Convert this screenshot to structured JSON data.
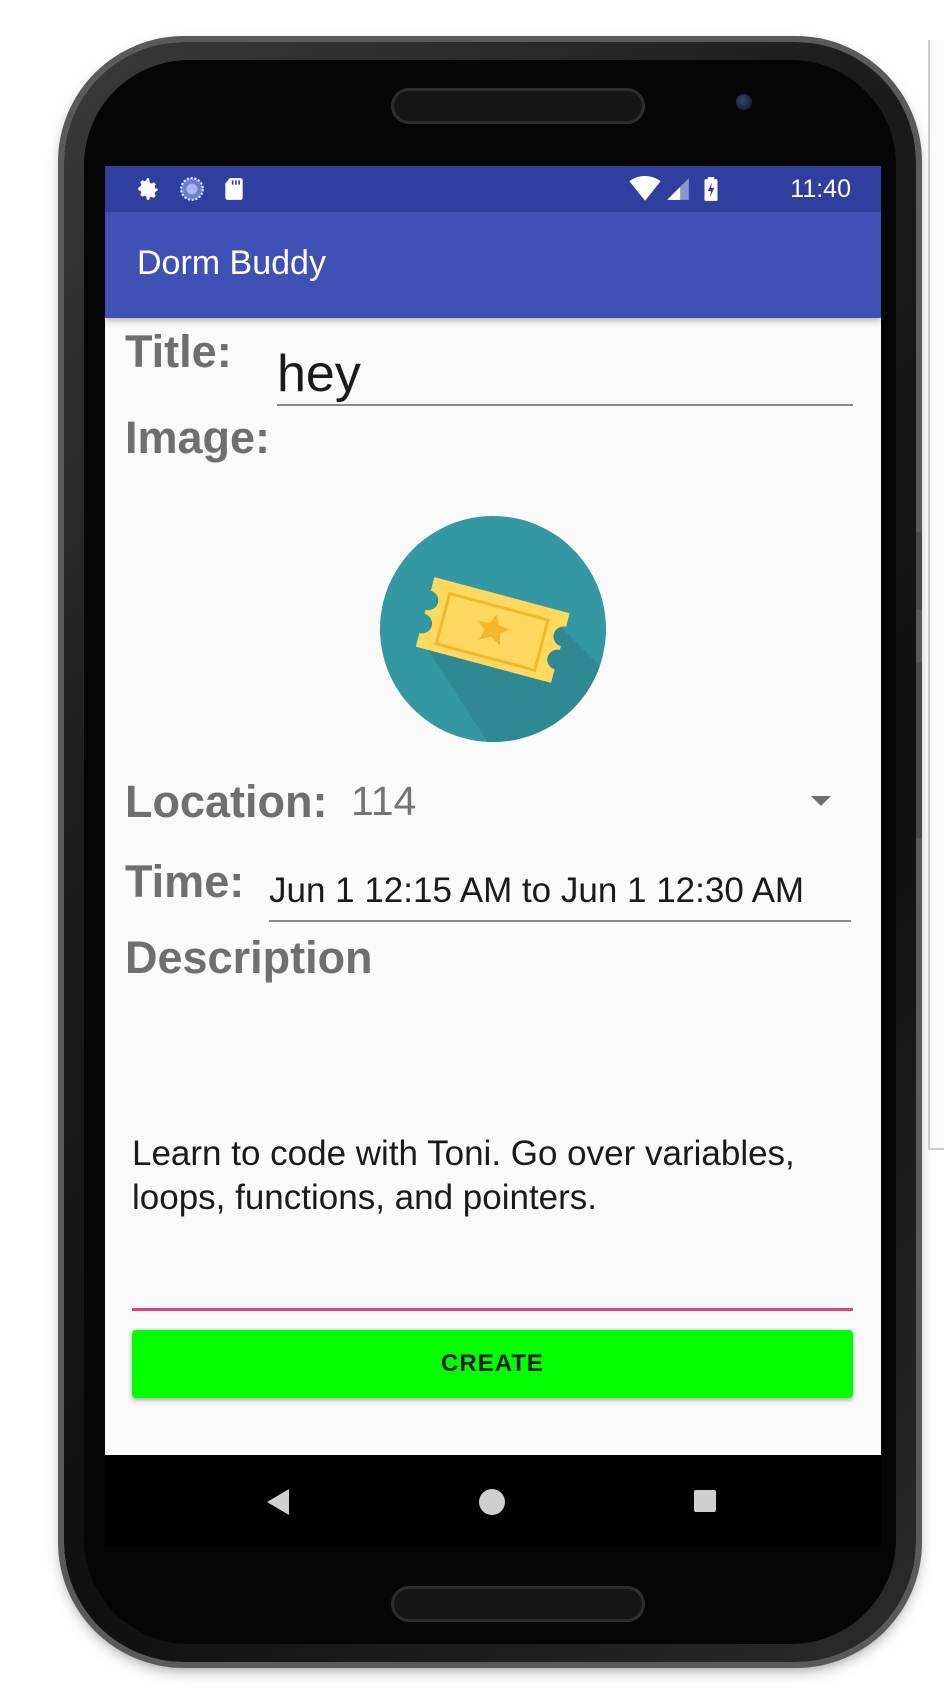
{
  "status_bar": {
    "time": "11:40",
    "left_icons": [
      "settings-icon",
      "sync-icon",
      "sd-card-icon"
    ],
    "right_icons": [
      "wifi-icon",
      "cell-signal-icon",
      "battery-charging-icon"
    ]
  },
  "app_bar": {
    "title": "Dorm Buddy"
  },
  "form": {
    "title_label": "Title:",
    "title_value": "hey",
    "image_label": "Image:",
    "image_icon": "ticket-icon",
    "location_label": "Location:",
    "location_value": "114",
    "time_label": "Time:",
    "time_value": "Jun 1 12:15 AM to Jun 1 12:30 AM",
    "description_label": "Description",
    "description_value": "Learn to code with Toni. Go over variables, loops, functions, and pointers.",
    "create_label": "CREATE"
  },
  "colors": {
    "status_bar": "#303f9f",
    "app_bar": "#3f51b5",
    "create_button": "#00ff00",
    "description_underline": "#ec407a",
    "image_circle": "#3498a2",
    "ticket": "#ffd85f"
  },
  "nav_bar": {
    "buttons": [
      "back-icon",
      "home-icon",
      "recent-apps-icon"
    ]
  }
}
